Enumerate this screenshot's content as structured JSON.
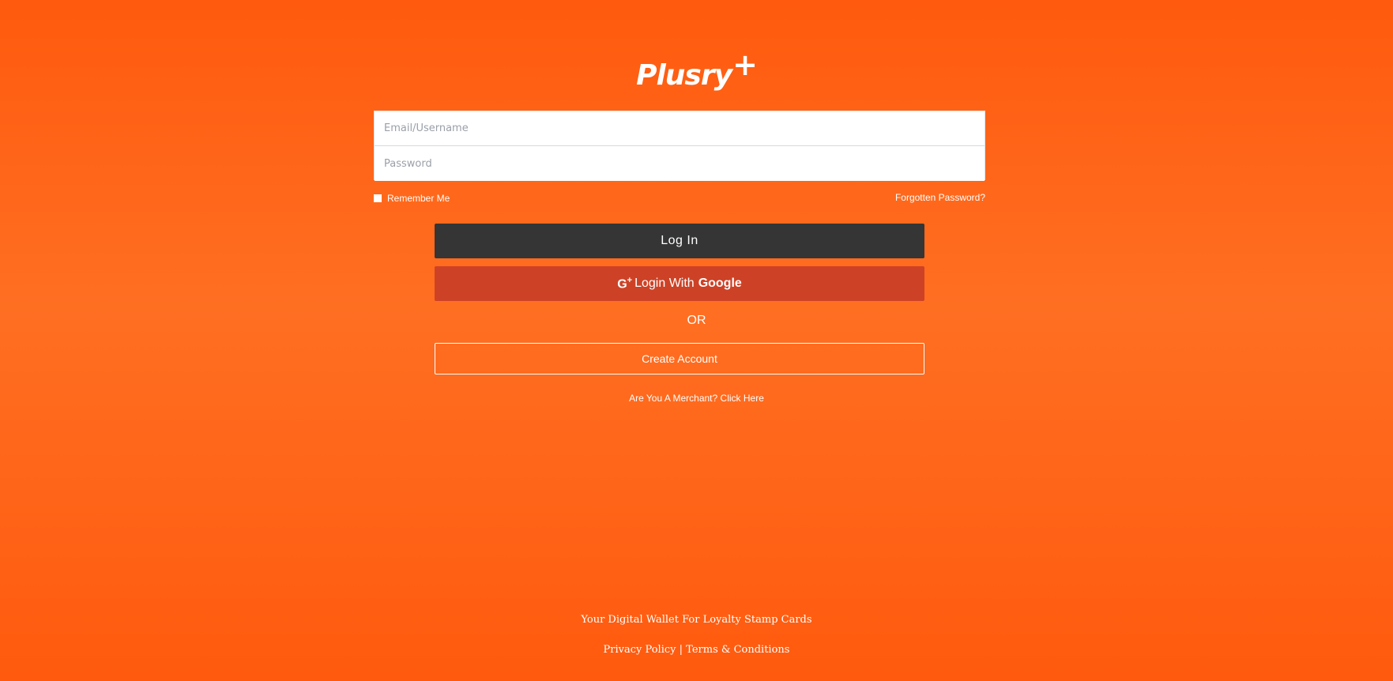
{
  "logo": {
    "text": "Plusry",
    "mark": "+"
  },
  "login_form": {
    "email_placeholder": "Email/Username",
    "email_value": "",
    "password_placeholder": "Password",
    "password_value": "",
    "remember_label": "Remember Me",
    "remember_checked": false,
    "forgot_label": "Forgotten Password?",
    "login_label": "Log In"
  },
  "google_button": {
    "icon": "google-plus-icon",
    "icon_text": "G",
    "icon_plus": "+",
    "label": "Login With",
    "brand": "Google"
  },
  "separator": "OR",
  "create_account_label": "Create Account",
  "merchant_link": "Are You A Merchant? Click Here",
  "footer": {
    "tagline": "Your Digital Wallet For Loyalty Stamp Cards",
    "privacy_label": "Privacy Policy",
    "divider": "|",
    "terms_label": "Terms & Conditions"
  },
  "colors": {
    "background": "#ff6418",
    "login_button": "#353535",
    "google_button": "#cd4226"
  }
}
